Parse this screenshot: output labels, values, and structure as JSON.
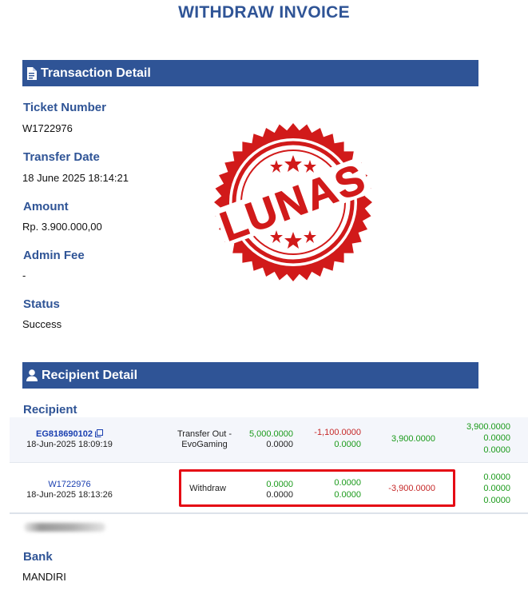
{
  "page_title": "WITHDRAW INVOICE",
  "transaction_section": {
    "title": "Transaction Detail",
    "icon": "document-icon",
    "fields": [
      {
        "label": "Ticket Number",
        "value": "W1722976"
      },
      {
        "label": "Transfer Date",
        "value": "18 June 2025 18:14:21"
      },
      {
        "label": "Amount",
        "value": "Rp. 3.900.000,00"
      },
      {
        "label": "Admin Fee",
        "value": "-"
      },
      {
        "label": "Status",
        "value": "Success"
      }
    ]
  },
  "stamp": {
    "text": "LUNAS",
    "color": "#d11a1a"
  },
  "recipient_section": {
    "title": "Recipient Detail",
    "icon": "user-icon",
    "recipient_label": "Recipient",
    "rows": [
      {
        "id": "EG818690102",
        "date": "18-Jun-2025 18:09:19",
        "description": "Transfer Out - EvoGaming",
        "col1": [
          "5,000.0000",
          "0.0000"
        ],
        "col2": [
          "-1,100.0000",
          "0.0000"
        ],
        "col3": "3,900.0000",
        "col4": [
          "3,900.0000",
          "0.0000",
          "0.0000"
        ]
      },
      {
        "id": "W1722976",
        "date": "18-Jun-2025 18:13:26",
        "description": "Withdraw",
        "col1": [
          "0.0000",
          "0.0000"
        ],
        "col2": [
          "0.0000",
          "0.0000"
        ],
        "col3": "-3,900.0000",
        "col4": [
          "0.0000",
          "0.0000",
          "0.0000"
        ]
      }
    ],
    "bank_label": "Bank",
    "bank_value": "MANDIRI"
  },
  "colors": {
    "primary": "#2f5496",
    "positive": "#1a9a1a",
    "negative": "#c62828",
    "highlight": "#e50914"
  }
}
